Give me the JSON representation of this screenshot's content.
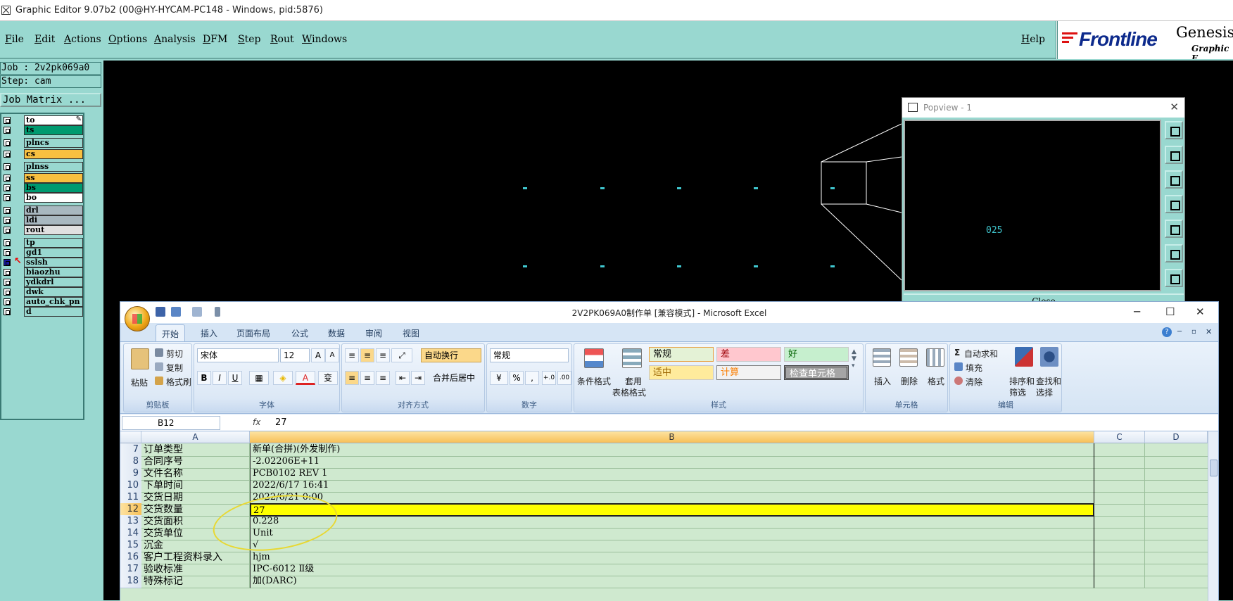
{
  "genesis": {
    "window_title": "Graphic Editor 9.07b2 (00@HY-HYCAM-PC148 - Windows, pid:5876)",
    "menu": [
      "File",
      "Edit",
      "Actions",
      "Options",
      "Analysis",
      "DFM",
      "Step",
      "Rout",
      "Windows"
    ],
    "help": "Help",
    "logo": {
      "brand": "Frontline",
      "product": "Genesis",
      "sub": "Graphic E"
    },
    "job_line": "Job : 2v2pk069a0",
    "step_line": "Step: cam",
    "job_matrix": "Job Matrix ...",
    "layers": [
      {
        "name": "to",
        "color": "#ffffff",
        "marker": "✎"
      },
      {
        "name": "ts",
        "color": "#009a70"
      },
      {
        "name": "plncs",
        "color": "#99d8d0"
      },
      {
        "name": "cs",
        "color": "#f8c040"
      },
      {
        "name": "plnss",
        "color": "#99d8d0"
      },
      {
        "name": "ss",
        "color": "#f8c040"
      },
      {
        "name": "bs",
        "color": "#009a70"
      },
      {
        "name": "bo",
        "color": "#ffffff"
      },
      {
        "name": "drl",
        "color": "#a8b8c0"
      },
      {
        "name": "ldi",
        "color": "#a8b8c0"
      },
      {
        "name": "rout",
        "color": "#e0e0e0"
      },
      {
        "name": "tp",
        "color": "#99d8d0"
      },
      {
        "name": "gd1",
        "color": "#99d8d0"
      },
      {
        "name": "sslsh",
        "color": "#99d8d0",
        "active": true
      },
      {
        "name": "biaozhu",
        "color": "#99d8d0"
      },
      {
        "name": "ydkdrl",
        "color": "#99d8d0"
      },
      {
        "name": "dwk",
        "color": "#99d8d0"
      },
      {
        "name": "auto_chk_pn",
        "color": "#99d8d0"
      },
      {
        "name": "d",
        "color": "#99d8d0"
      }
    ],
    "popview": {
      "title": "Popview - 1",
      "label": "025",
      "close": "Close"
    }
  },
  "excel": {
    "title": "2V2PK069A0制作单 [兼容模式] - Microsoft Excel",
    "tabs": [
      "开始",
      "插入",
      "页面布局",
      "公式",
      "数据",
      "审阅",
      "视图"
    ],
    "clipboard": {
      "paste": "粘贴",
      "cut": "剪切",
      "copy": "复制",
      "format_painter": "格式刷",
      "label": "剪贴板"
    },
    "font": {
      "name": "宋体",
      "size": "12",
      "label": "字体",
      "bold": "B",
      "italic": "I",
      "underline": "U",
      "grow": "A",
      "wen": "变"
    },
    "alignment": {
      "wrap": "自动换行",
      "merge": "合并后居中",
      "label": "对齐方式"
    },
    "number": {
      "format": "常规",
      "label": "数字",
      "percent": "%",
      "comma": ",",
      "inc": "+.0",
      "dec": ".00"
    },
    "styles": {
      "cond_format": "条件格式",
      "table_format": "套用",
      "table_format2": "表格格式",
      "normal": "常规",
      "bad": "差",
      "good": "好",
      "neutral": "适中",
      "calc": "计算",
      "check": "检查单元格",
      "label": "样式"
    },
    "cells": {
      "insert": "插入",
      "delete": "删除",
      "format": "格式",
      "label": "单元格"
    },
    "editing": {
      "autosum": "自动求和",
      "fill": "填充",
      "clear": "清除",
      "sort": "排序和",
      "sort2": "筛选",
      "find": "查找和",
      "find2": "选择",
      "label": "编辑"
    },
    "name_box": "B12",
    "fx": "fx",
    "formula_value": "27",
    "columns": [
      "A",
      "B",
      "C",
      "D"
    ],
    "rows": [
      {
        "n": "7",
        "a": "订单类型",
        "b": "新单(合拼)(外发制作)"
      },
      {
        "n": "8",
        "a": "合同序号",
        "b": "-2.02206E+11"
      },
      {
        "n": "9",
        "a": "文件名称",
        "b": "PCB0102 REV 1"
      },
      {
        "n": "10",
        "a": "下单时间",
        "b": "2022/6/17 16:41"
      },
      {
        "n": "11",
        "a": "交货日期",
        "b": "2022/6/21 0:00"
      },
      {
        "n": "12",
        "a": "交货数量",
        "b": "27",
        "selected": true
      },
      {
        "n": "13",
        "a": "交货面积",
        "b": "0.228"
      },
      {
        "n": "14",
        "a": "交货单位",
        "b": "Unit"
      },
      {
        "n": "15",
        "a": "沉金",
        "b": "√"
      },
      {
        "n": "16",
        "a": "客户工程资料录入",
        "b": "hjm"
      },
      {
        "n": "17",
        "a": "验收标准",
        "b": "IPC-6012 Ⅱ级"
      },
      {
        "n": "18",
        "a": "特殊标记",
        "b": "加(DARC)"
      }
    ]
  }
}
